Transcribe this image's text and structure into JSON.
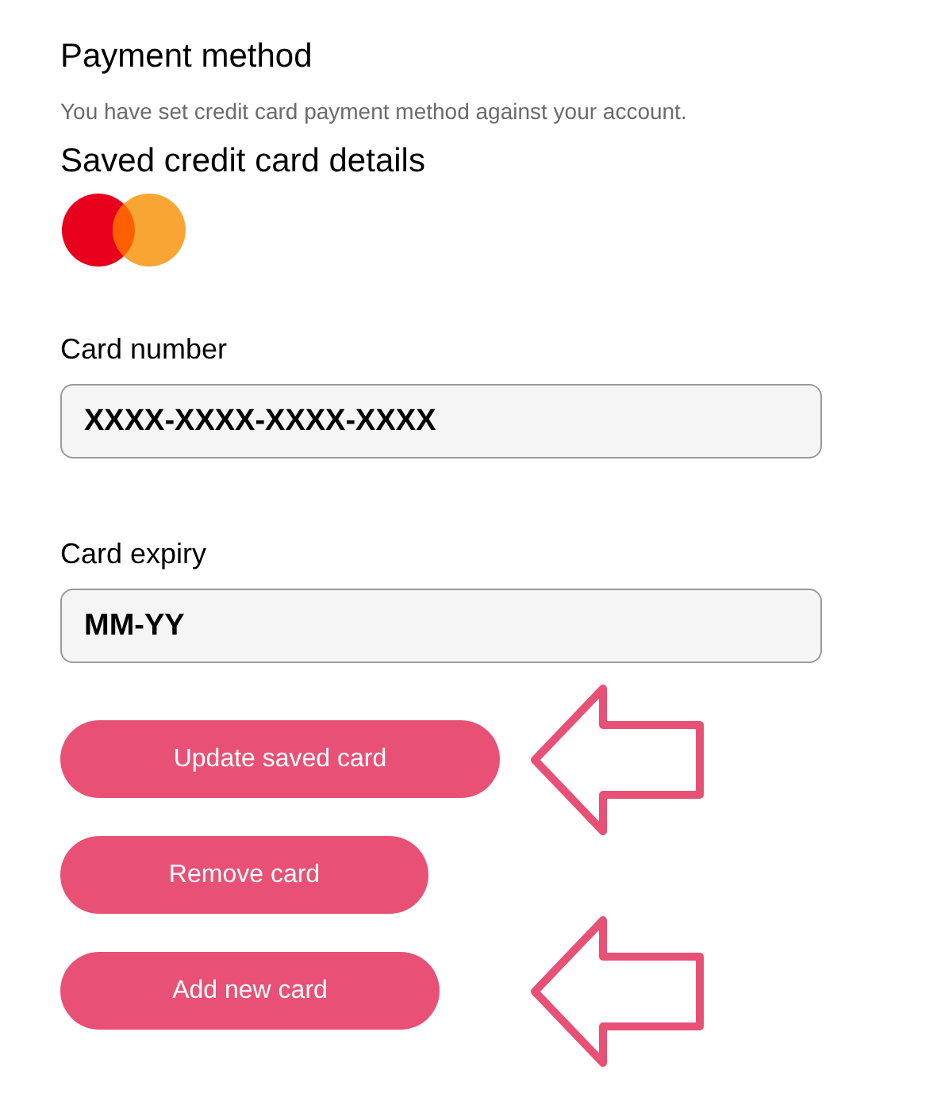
{
  "title": "Payment method",
  "subtitle": "You have set credit card payment method against your account.",
  "card_heading": "Saved credit card details",
  "fields": [
    {
      "label": "Card number",
      "value": "XXXX-XXXX-XXXX-XXXX"
    },
    {
      "label": "Card expiry",
      "value": "MM-YY"
    }
  ],
  "buttons": [
    {
      "label": "Update saved card",
      "pointed_at": true
    },
    {
      "label": "Remove card",
      "pointed_at": false
    },
    {
      "label": "Add new card",
      "pointed_at": true
    }
  ]
}
